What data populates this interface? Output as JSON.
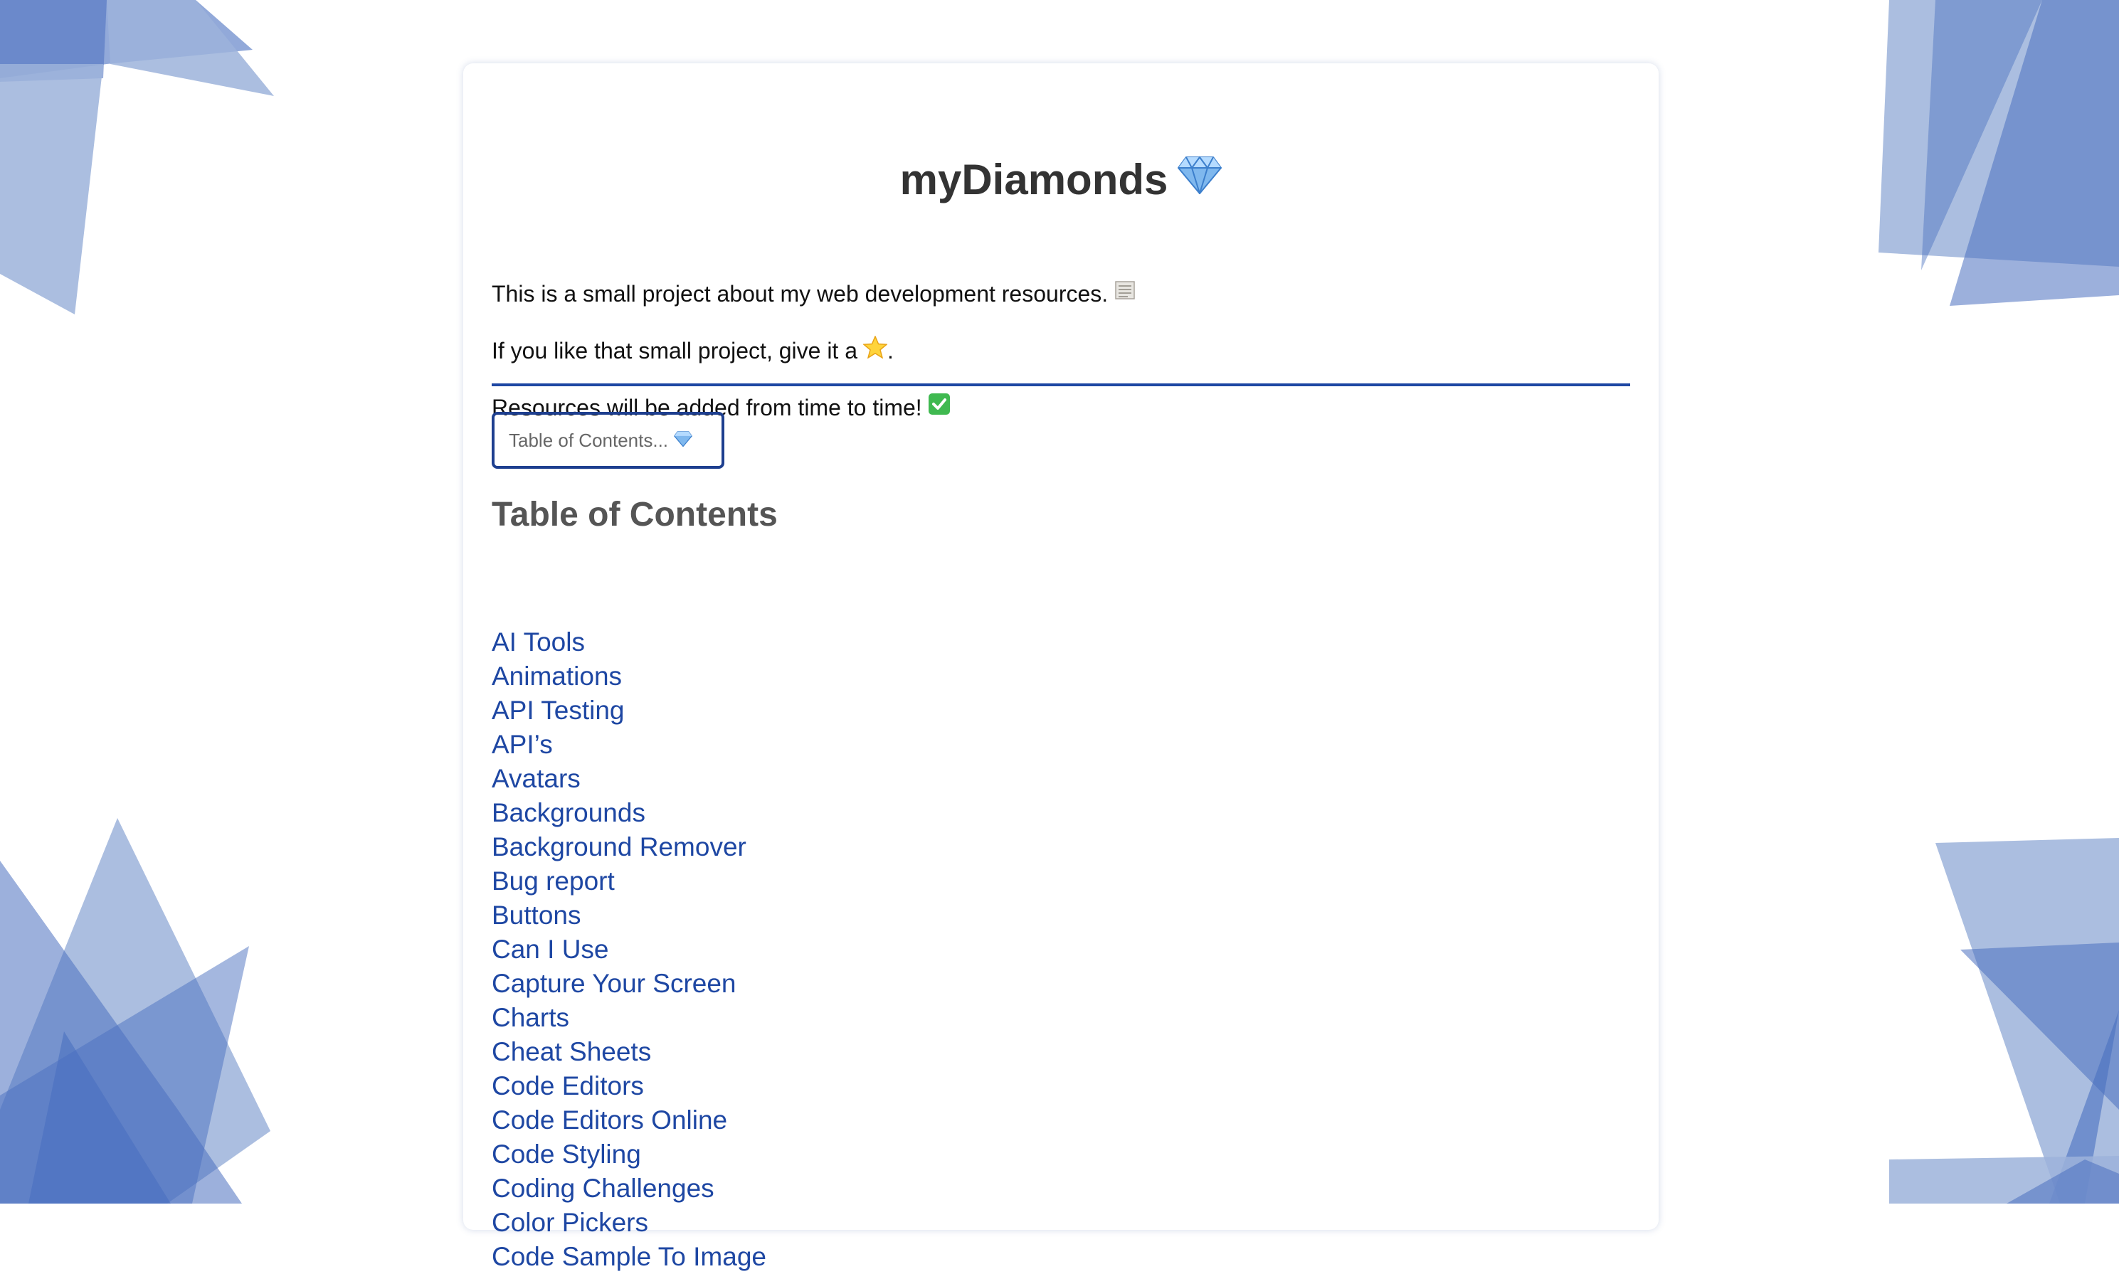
{
  "page": {
    "title": "myDiamonds",
    "title_emoji": "gem-icon",
    "intro": [
      {
        "text": "This is a small project about my web development resources.",
        "icon": "scroll-icon"
      },
      {
        "text": "If you like that small project, give it a",
        "icon": "star-icon",
        "suffix": "."
      },
      {
        "text": "Resources will be added from time to time!",
        "icon": "check-icon"
      }
    ]
  },
  "search": {
    "placeholder": "Table of Contents...",
    "icon": "gem-icon"
  },
  "toc": {
    "heading": "Table of Contents",
    "items": [
      "AI Tools",
      "Animations",
      "API Testing",
      "API’s",
      "Avatars",
      "Backgrounds",
      "Background Remover",
      "Bug report",
      "Buttons",
      "Can I Use",
      "Capture Your Screen",
      "Charts",
      "Cheat Sheets",
      "Code Editors",
      "Code Editors Online",
      "Code Styling",
      "Coding Challenges",
      "Color Pickers",
      "Code Sample To Image"
    ]
  },
  "colors": {
    "accent": "#1e47a3",
    "decor_light": "#9cb3db",
    "decor_mid": "#6a8bc8",
    "decor_dark": "#4a70bf"
  }
}
